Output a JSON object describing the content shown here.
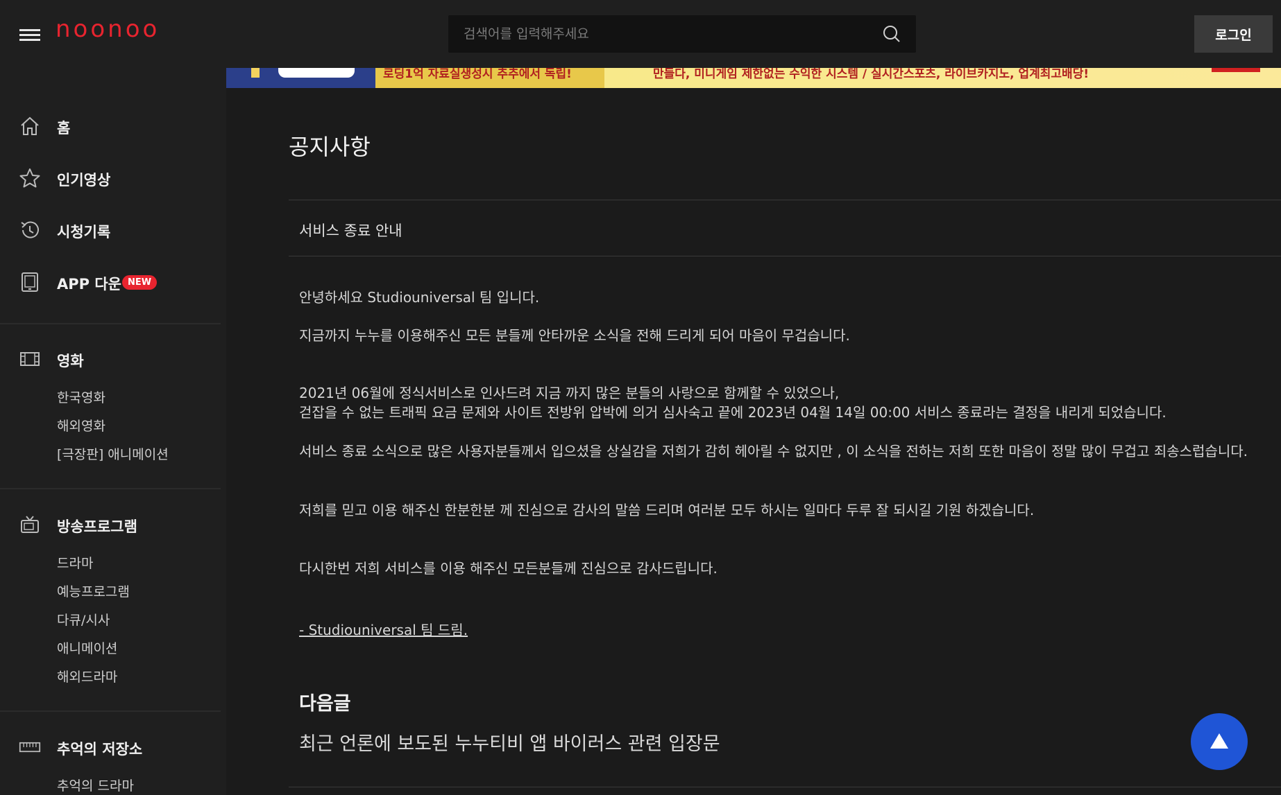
{
  "header": {
    "logo": "noonoo",
    "search_placeholder": "검색어를 입력해주세요",
    "login_label": "로그인"
  },
  "sidebar": {
    "main_items": [
      {
        "label": "홈",
        "icon": "home-icon"
      },
      {
        "label": "인기영상",
        "icon": "star-icon"
      },
      {
        "label": "시청기록",
        "icon": "history-icon"
      },
      {
        "label": "APP 다운",
        "icon": "tablet-icon",
        "badge": "NEW"
      }
    ],
    "sections": [
      {
        "label": "영화",
        "icon": "film-icon",
        "items": [
          "한국영화",
          "해외영화",
          "[극장판] 애니메이션"
        ]
      },
      {
        "label": "방송프로그램",
        "icon": "tv-icon",
        "items": [
          "드라마",
          "예능프로그램",
          "다큐/시사",
          "애니메이션",
          "해외드라마"
        ]
      },
      {
        "label": "추억의 저장소",
        "icon": "archive-icon",
        "items": [
          "추억의 드라마"
        ]
      }
    ]
  },
  "banner": {
    "text_left": "로딩1억 자료실생성시 추추에서 독립!",
    "text_right": "만들다, 미니게임 제한없는 수익한 시스템 / 실시간스포츠, 라이브카지노, 업계최고배당!"
  },
  "notice": {
    "page_title": "공지사항",
    "post_title": "서비스 종료 안내",
    "paragraphs": [
      "안녕하세요 Studiouniversal 팀 입니다.",
      "지금까지 누누를 이용해주신 모든 분들께 안타까운 소식을 전해 드리게 되어 마음이 무겁습니다.",
      "2021년 06월에 정식서비스로 인사드려 지금 까지 많은 분들의 사랑으로 함께할 수 있었으나,\n걷잡을 수 없는 트래픽 요금 문제와 사이트 전방위 압박에 의거 심사숙고 끝에 2023년 04월 14일 00:00 서비스 종료라는 결정을 내리게 되었습니다.",
      "서비스 종료 소식으로 많은 사용자분들께서 입으셨을 상실감을 저희가 감히 헤아릴 수 없지만 , 이 소식을 전하는 저희 또한 마음이 정말 많이 무겁고 죄송스럽습니다.",
      "저희를 믿고 이용 해주신 한분한분 께 진심으로 감사의 말씀 드리며 여러분 모두 하시는 일마다 두루 잘 되시길 기원 하겠습니다.",
      "다시한번 저희 서비스를 이용 해주신 모든분들께 진심으로 감사드립니다."
    ],
    "signature": "- Studiouniversal 팀 드림.",
    "next_label": "다음글",
    "next_title": "최근 언론에 보도된 누누티비 앱 바이러스 관련 입장문"
  },
  "colors": {
    "accent_red": "#e8242f",
    "top_button_blue": "#1f55d6"
  },
  "scroll_top_icon": "arrow-up-icon"
}
